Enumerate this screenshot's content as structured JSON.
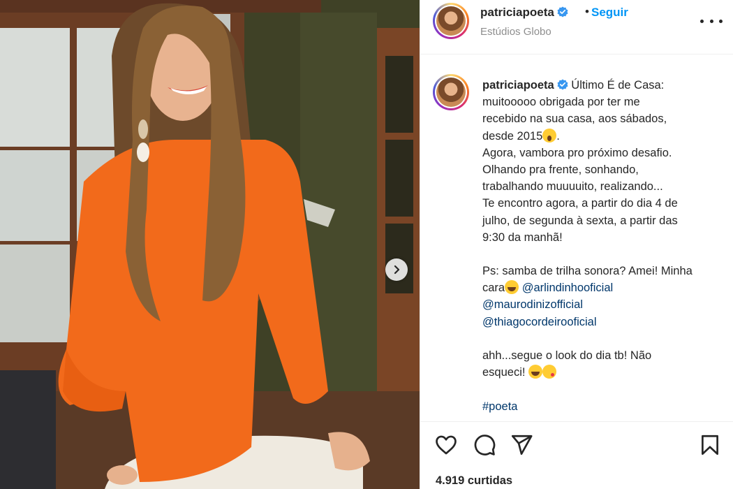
{
  "post": {
    "username": "patriciapoeta",
    "follow_label": "Seguir",
    "separator": "•",
    "location": "Estúdios Globo",
    "likes_text": "4.919 curtidas"
  },
  "caption": {
    "username": "patriciapoeta",
    "lines": [
      "Último É de Casa:",
      "muitooooo obrigada por ter me",
      "recebido na sua casa, aos sábados,",
      "desde 2015",
      ".",
      "Agora, vambora pro próximo desafio.",
      "Olhando pra frente, sonhando,",
      "trabalhando muuuuito, realizando...",
      "Te encontro agora, a partir do dia 4 de",
      "julho, de segunda à sexta, a partir das",
      "9:30 da manhã!",
      "Ps: samba de trilha sonora? Amei! Minha",
      "cara",
      "ahh...segue o look do dia tb! Não",
      "esqueci!"
    ],
    "mentions": [
      "@arlindinhooficial",
      "@maurodinizofficial",
      "@thiagocordeirooficial"
    ],
    "hashtag": "#poeta"
  },
  "icons": {
    "verified": "verified-badge-icon",
    "more": "more-options-icon",
    "like": "heart-icon",
    "comment": "comment-icon",
    "share": "paper-plane-icon",
    "save": "bookmark-icon",
    "carousel_next": "chevron-right-icon"
  },
  "colors": {
    "link_blue": "#0095f6",
    "mention_blue": "#00376b",
    "text": "#262626",
    "secondary_text": "#8e8e8e",
    "dress_orange": "#f26a1b"
  }
}
